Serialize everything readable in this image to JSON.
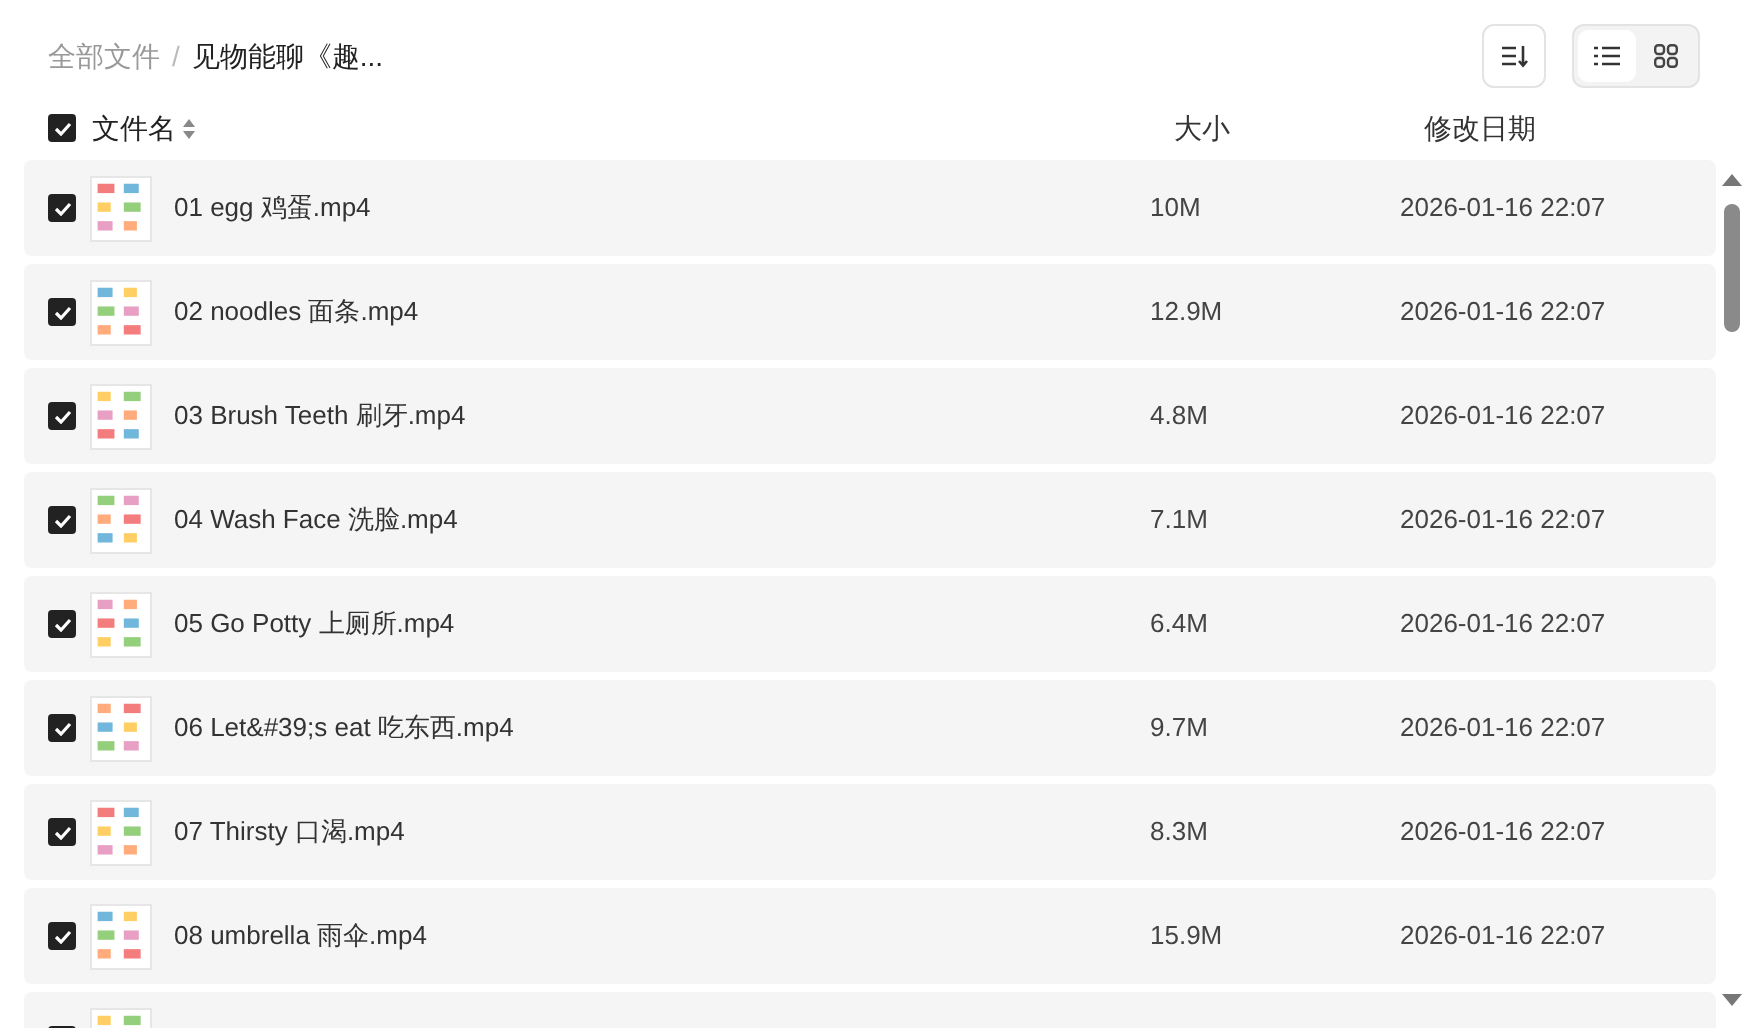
{
  "breadcrumb": [
    {
      "label": "全部文件",
      "current": false
    },
    {
      "separator": "/",
      "label": "见物能聊《趣...",
      "current": true
    }
  ],
  "view_modes": [
    {
      "kind": "list",
      "selected": true
    },
    {
      "kind": "grid",
      "selected": false
    }
  ],
  "select_all": {
    "checked": true
  },
  "columns": [
    "文件名",
    "大小",
    "修改日期"
  ],
  "rows": [
    {
      "checked": true,
      "name": "01 egg 鸡蛋.mp4",
      "size": "10M",
      "modified": "2026-01-16 22:07"
    },
    {
      "checked": true,
      "name": "02 noodles 面条.mp4",
      "size": "12.9M",
      "modified": "2026-01-16 22:07"
    },
    {
      "checked": true,
      "name": "03 Brush Teeth 刷牙.mp4",
      "size": "4.8M",
      "modified": "2026-01-16 22:07"
    },
    {
      "checked": true,
      "name": "04 Wash Face 洗脸.mp4",
      "size": "7.1M",
      "modified": "2026-01-16 22:07"
    },
    {
      "checked": true,
      "name": "05 Go Potty 上厕所.mp4",
      "size": "6.4M",
      "modified": "2026-01-16 22:07"
    },
    {
      "checked": true,
      "name": "06 Let&#39;s eat 吃东西.mp4",
      "size": "9.7M",
      "modified": "2026-01-16 22:07"
    },
    {
      "checked": true,
      "name": "07 Thirsty 口渴.mp4",
      "size": "8.3M",
      "modified": "2026-01-16 22:07"
    },
    {
      "checked": true,
      "name": "08 umbrella 雨伞.mp4",
      "size": "15.9M",
      "modified": "2026-01-16 22:07"
    },
    {
      "checked": true
    }
  ]
}
